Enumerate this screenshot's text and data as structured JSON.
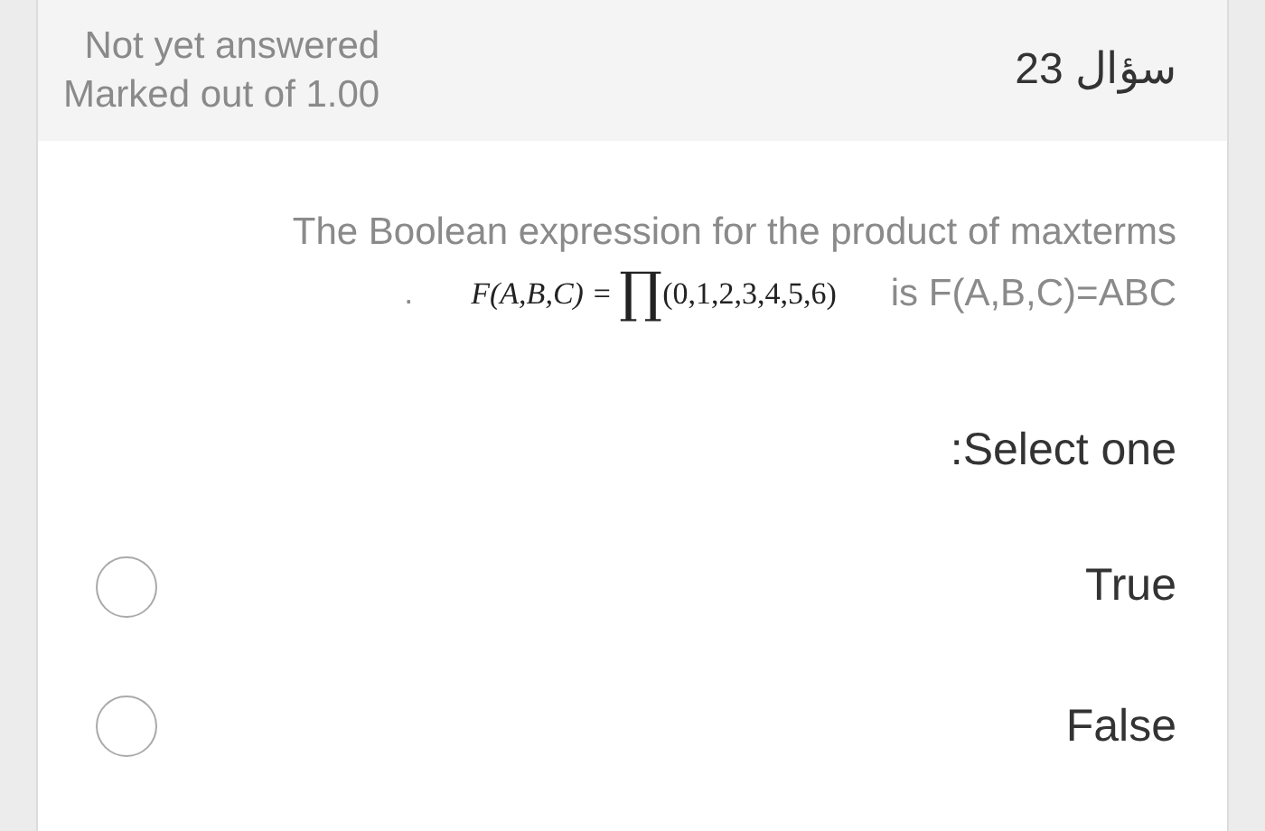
{
  "header": {
    "status": "Not yet answered",
    "marks": "Marked out of 1.00",
    "question_number": "سؤال 23"
  },
  "question": {
    "text": "The Boolean expression for the product of maxterms",
    "dot": ".",
    "formula_lhs": "F(A,B,C) =",
    "formula_symbol": "∏",
    "formula_args": "(0,1,2,3,4,5,6)",
    "text_end": "is F(A,B,C)=ABC"
  },
  "prompt": ":Select one",
  "options": [
    {
      "label": "True",
      "selected": false
    },
    {
      "label": "False",
      "selected": false
    }
  ]
}
